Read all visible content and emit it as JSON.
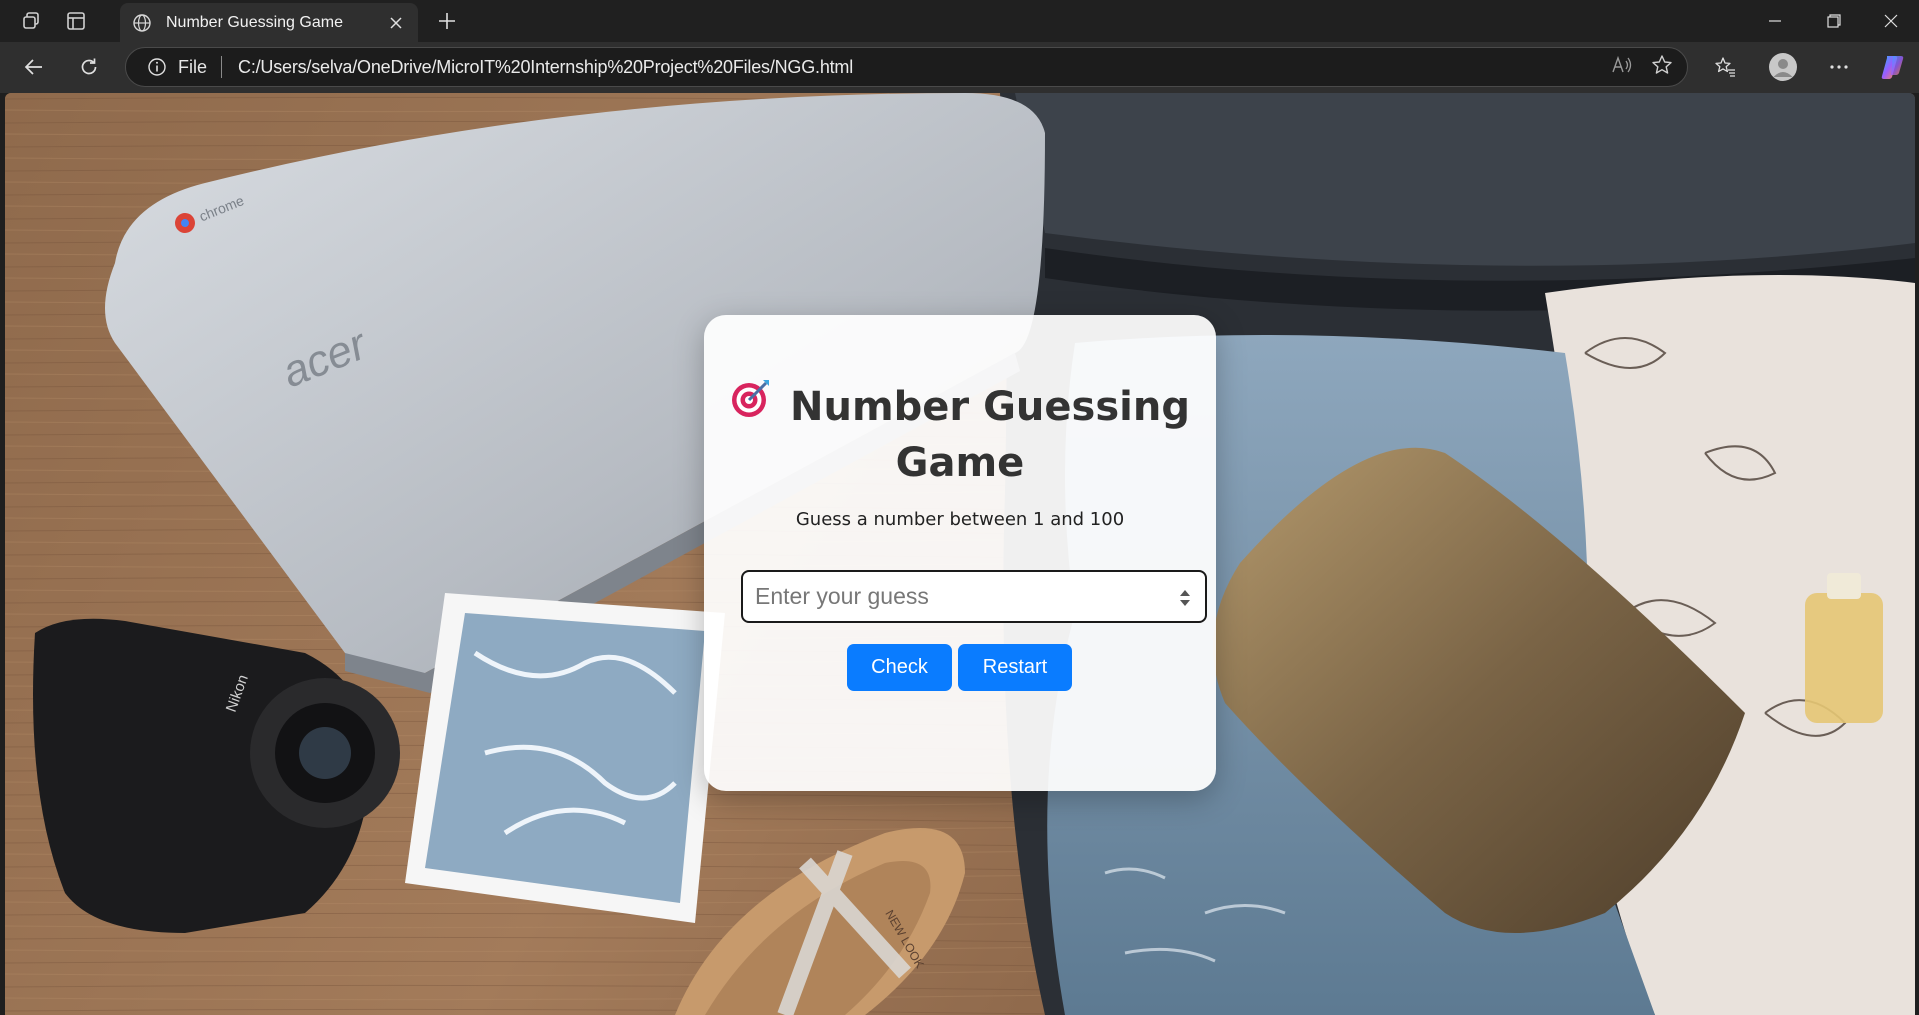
{
  "browser": {
    "tab_title": "Number Guessing Game",
    "address_prefix": "File",
    "url": "C:/Users/selva/OneDrive/MicroIT%20Internship%20Project%20Files/NGG.html"
  },
  "game": {
    "emoji": "🎯",
    "title": "Number Guessing Game",
    "subtitle": "Guess a number between 1 and 100",
    "input_placeholder": "Enter your guess",
    "input_value": "",
    "check_label": "Check",
    "restart_label": "Restart",
    "accent_color": "#0a7cff"
  },
  "background": {
    "laptop_logo_text": "chrome",
    "laptop_brand_text": "acer",
    "camera_brand_text": "Nikon",
    "sandal_brand_text": "NEW LOOK"
  }
}
